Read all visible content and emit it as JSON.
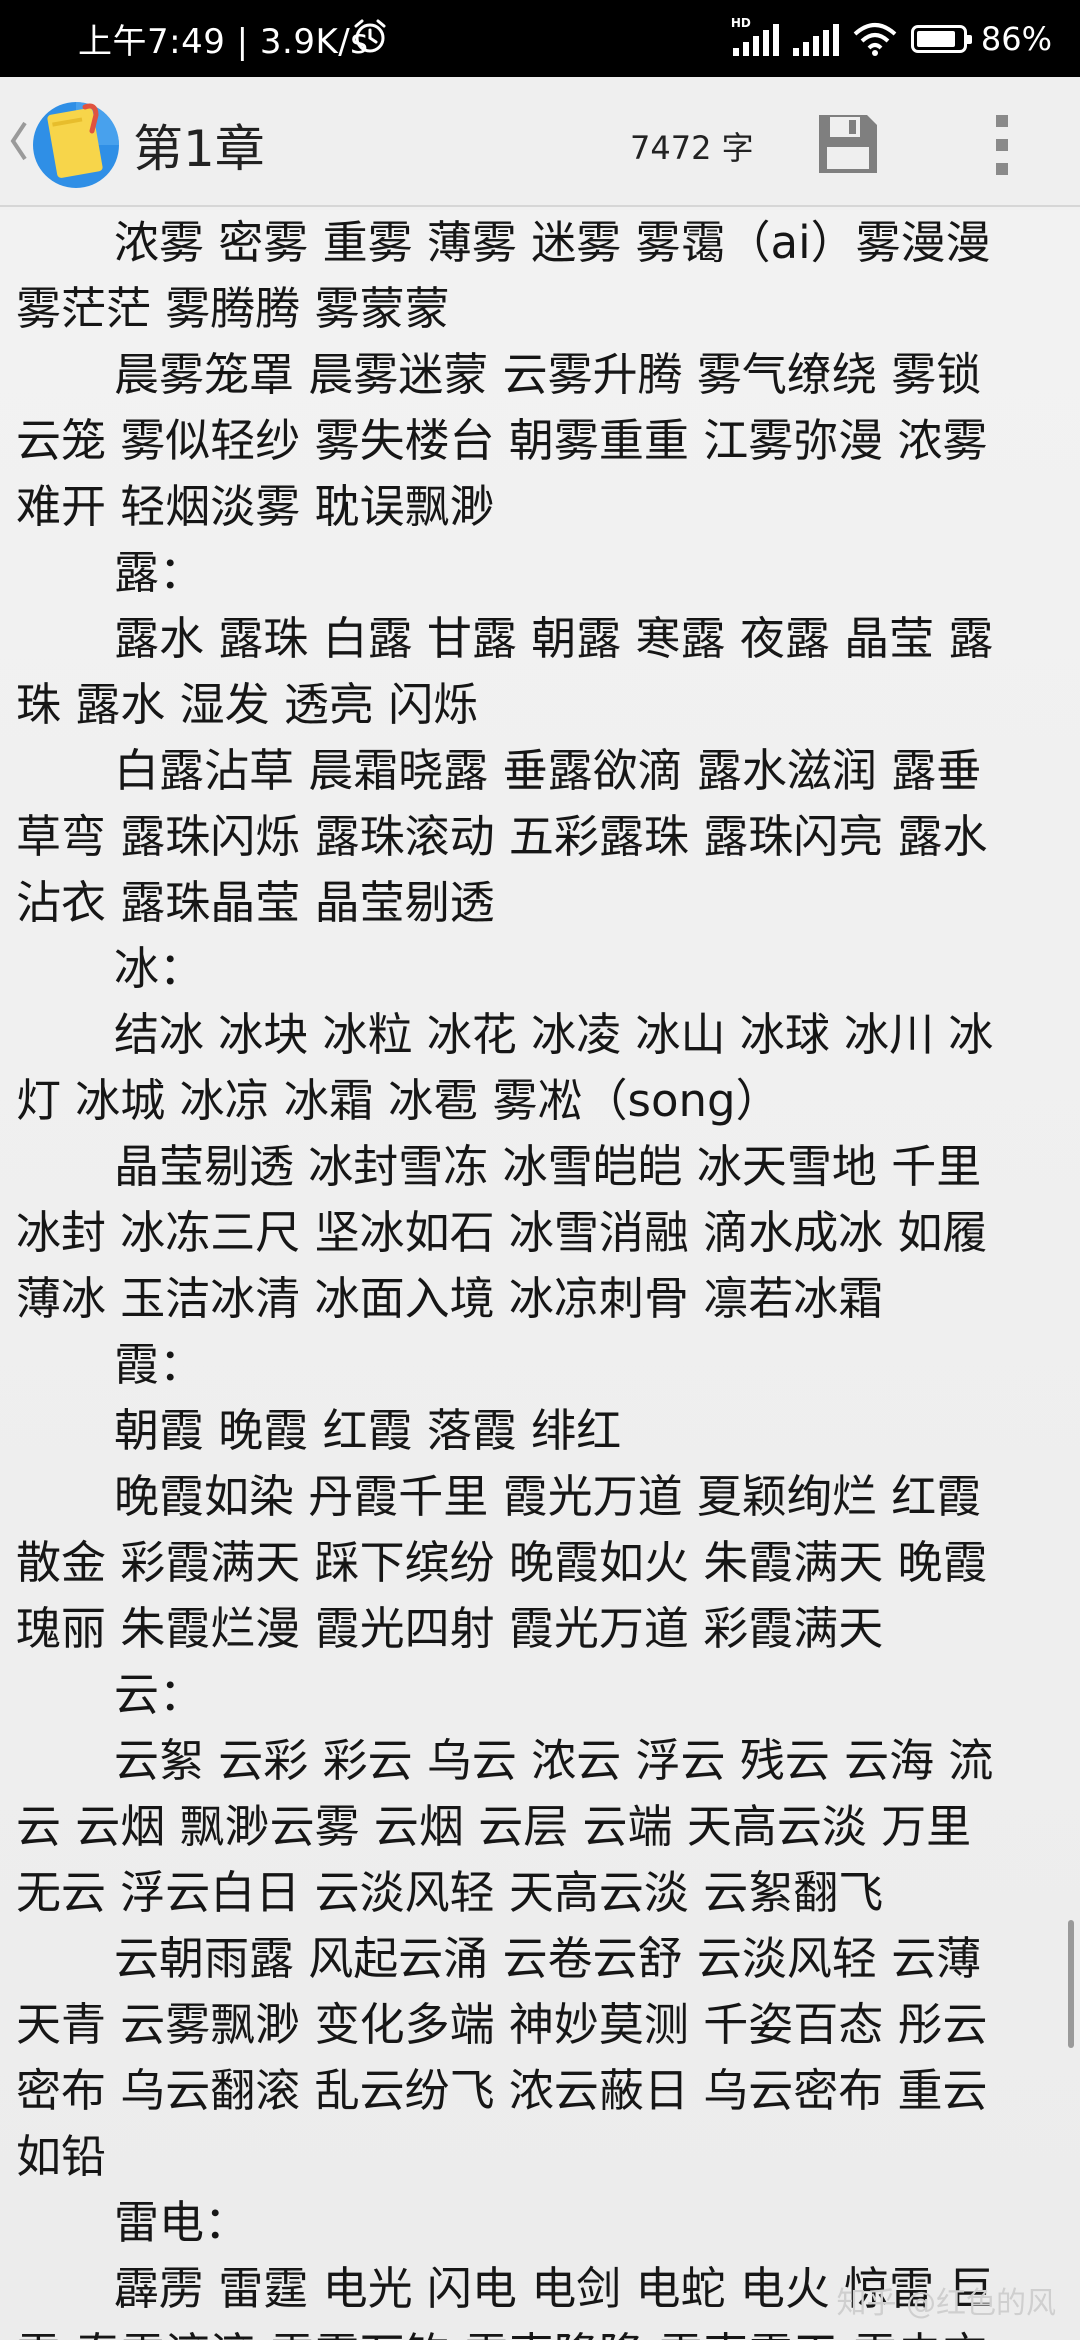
{
  "status_bar": {
    "time_speed": "上午7:49 | 3.9K/s",
    "battery_percent": "86%",
    "battery_level": 0.86,
    "icons": [
      "alarm-icon",
      "hd-signal-icon",
      "signal-icon",
      "wifi-icon",
      "battery-icon"
    ]
  },
  "toolbar": {
    "back_icon": "chevron-left-icon",
    "app_icon": "notebook-icon",
    "chapter_title": "第1章",
    "word_count": "7472 字",
    "save_icon": "save-icon",
    "more_icon": "more-vertical-icon",
    "colors": {
      "app_icon_blue": "#2f8fe6",
      "note_yellow": "#f7d54a",
      "clip_red": "#e0533f"
    }
  },
  "content": {
    "lines": [
      {
        "indent": true,
        "text": "浓雾 密雾 重雾 薄雾 迷雾 雾霭（ai）雾漫漫"
      },
      {
        "indent": false,
        "text": "雾茫茫 雾腾腾 雾蒙蒙"
      },
      {
        "indent": true,
        "text": "晨雾笼罩 晨雾迷蒙 云雾升腾 雾气缭绕 雾锁"
      },
      {
        "indent": false,
        "text": "云笼 雾似轻纱 雾失楼台 朝雾重重 江雾弥漫 浓雾"
      },
      {
        "indent": false,
        "text": "难开 轻烟淡雾 耽误飘渺"
      },
      {
        "indent": true,
        "text": "露："
      },
      {
        "indent": true,
        "text": "露水 露珠 白露 甘露 朝露 寒露 夜露 晶莹 露"
      },
      {
        "indent": false,
        "text": "珠 露水 湿发 透亮 闪烁"
      },
      {
        "indent": true,
        "text": "白露沾草 晨霜晓露 垂露欲滴 露水滋润 露垂"
      },
      {
        "indent": false,
        "text": "草弯 露珠闪烁 露珠滚动 五彩露珠 露珠闪亮 露水"
      },
      {
        "indent": false,
        "text": "沾衣 露珠晶莹 晶莹剔透"
      },
      {
        "indent": true,
        "text": "冰："
      },
      {
        "indent": true,
        "text": "结冰 冰块 冰粒 冰花 冰凌 冰山 冰球 冰川 冰"
      },
      {
        "indent": false,
        "text": "灯 冰城 冰凉 冰霜 冰雹 雾凇（song）"
      },
      {
        "indent": true,
        "text": "晶莹剔透 冰封雪冻 冰雪皑皑 冰天雪地 千里"
      },
      {
        "indent": false,
        "text": "冰封 冰冻三尺 坚冰如石 冰雪消融 滴水成冰 如履"
      },
      {
        "indent": false,
        "text": "薄冰 玉洁冰清 冰面入境 冰凉刺骨 凛若冰霜"
      },
      {
        "indent": true,
        "text": "霞："
      },
      {
        "indent": true,
        "text": "朝霞 晚霞 红霞 落霞 绯红"
      },
      {
        "indent": true,
        "text": "晚霞如染 丹霞千里 霞光万道 夏颖绚烂 红霞"
      },
      {
        "indent": false,
        "text": "散金 彩霞满天 踩下缤纷 晚霞如火 朱霞满天 晚霞"
      },
      {
        "indent": false,
        "text": "瑰丽 朱霞烂漫 霞光四射 霞光万道 彩霞满天"
      },
      {
        "indent": true,
        "text": "云："
      },
      {
        "indent": true,
        "text": "云絮 云彩 彩云 乌云 浓云 浮云 残云 云海 流"
      },
      {
        "indent": false,
        "text": "云 云烟 飘渺云雾 云烟 云层 云端 天高云淡 万里"
      },
      {
        "indent": false,
        "text": "无云 浮云白日 云淡风轻 天高云淡 云絮翻飞"
      },
      {
        "indent": true,
        "text": "云朝雨露 风起云涌 云卷云舒 云淡风轻 云薄"
      },
      {
        "indent": false,
        "text": "天青 云雾飘渺 变化多端 神妙莫测 千姿百态 彤云"
      },
      {
        "indent": false,
        "text": "密布 乌云翻滚 乱云纷飞 浓云蔽日 乌云密布 重云"
      },
      {
        "indent": false,
        "text": "如铅"
      },
      {
        "indent": true,
        "text": "雷电："
      },
      {
        "indent": true,
        "text": "霹雳 雷霆 电光 闪电 电剑 电蛇 电火 惊雷 巨"
      },
      {
        "indent": false,
        "text": "雷 春雷滚滚 雷霆万钧 雷声隆隆 雷声震天 雷电交"
      }
    ]
  },
  "watermark": "知乎 @红色的风"
}
